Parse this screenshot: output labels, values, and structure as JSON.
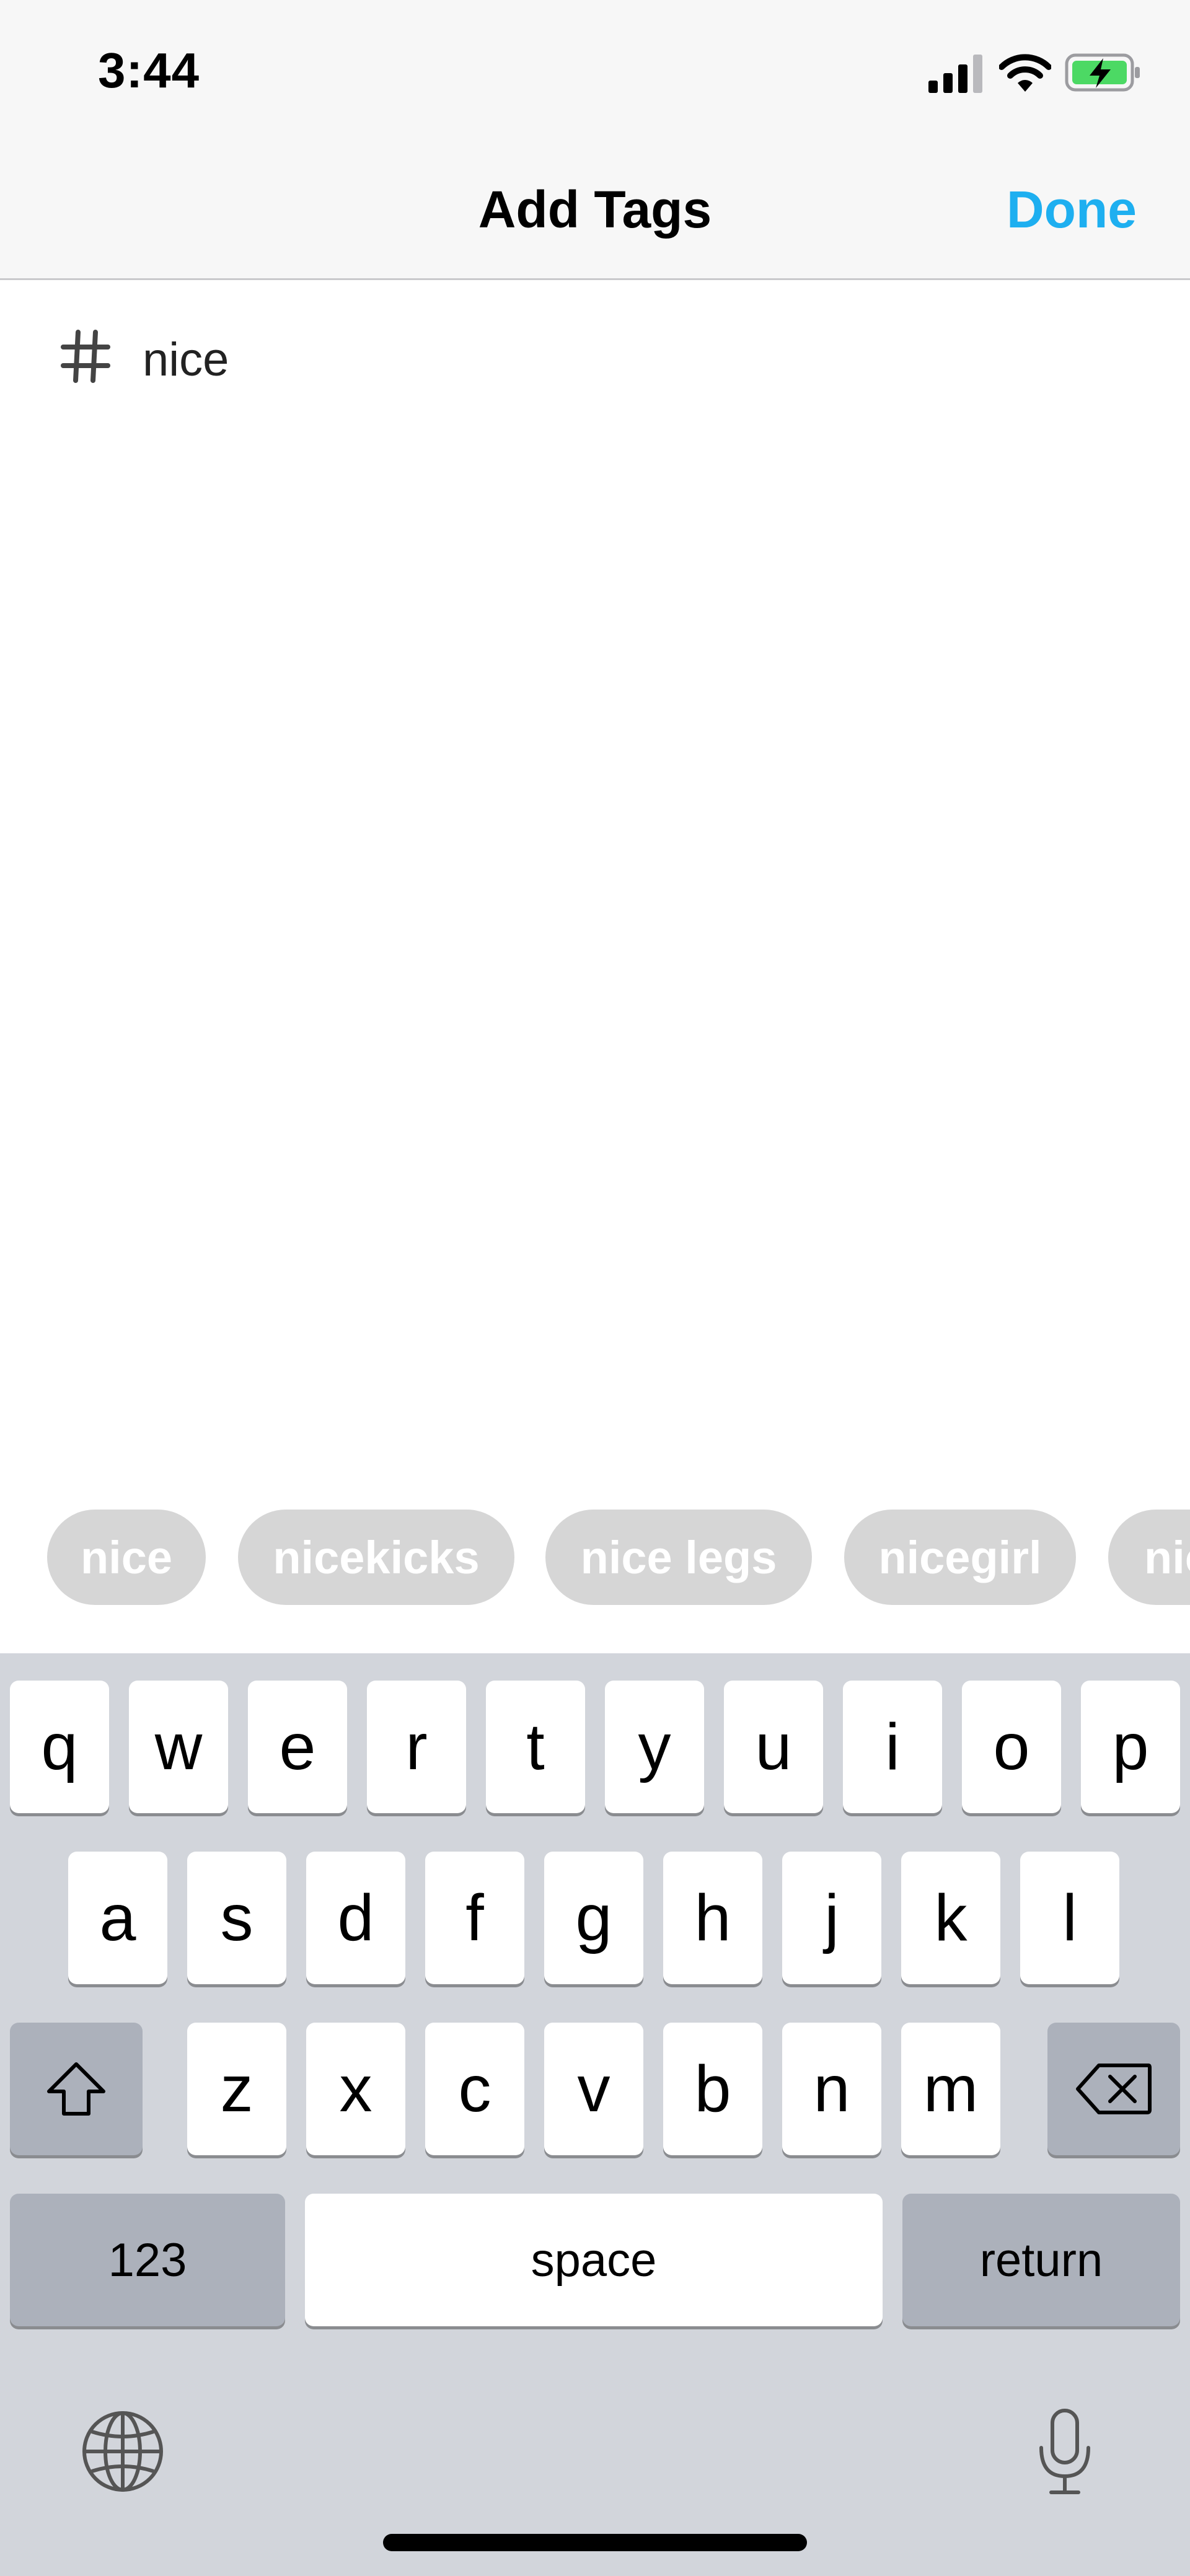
{
  "status_bar": {
    "time": "3:44",
    "icons": [
      "cellular-signal-icon",
      "wifi-icon",
      "battery-charging-icon"
    ],
    "battery_color": "#4cd964"
  },
  "nav": {
    "title": "Add Tags",
    "done_label": "Done",
    "accent_color": "#1eaff0"
  },
  "tag_input": {
    "icon": "hashtag-icon",
    "value": "nice"
  },
  "suggestions": [
    {
      "label": "nice"
    },
    {
      "label": "nicekicks"
    },
    {
      "label": "nice legs"
    },
    {
      "label": "nicegirl"
    },
    {
      "label": "nic"
    }
  ],
  "keyboard": {
    "row1": [
      "q",
      "w",
      "e",
      "r",
      "t",
      "y",
      "u",
      "i",
      "o",
      "p"
    ],
    "row2": [
      "a",
      "s",
      "d",
      "f",
      "g",
      "h",
      "j",
      "k",
      "l"
    ],
    "row3": [
      "z",
      "x",
      "c",
      "v",
      "b",
      "n",
      "m"
    ],
    "shift_icon": "shift-icon",
    "delete_icon": "backspace-icon",
    "numbers_label": "123",
    "space_label": "space",
    "return_label": "return",
    "globe_icon": "globe-icon",
    "mic_icon": "microphone-icon"
  }
}
